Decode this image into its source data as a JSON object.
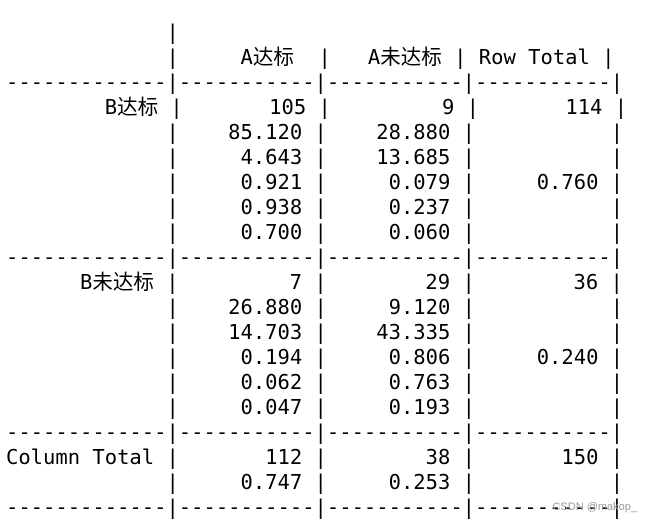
{
  "table": {
    "lines": [
      "             |",
      "             |     A达标  |   A未达标 | Row Total |",
      "-------------|-----------|-----------|-----------|",
      "        B达标 |       105 |         9 |       114 |",
      "             |    85.120 |    28.880 |           |",
      "             |     4.643 |    13.685 |           |",
      "             |     0.921 |     0.079 |     0.760 |",
      "             |     0.938 |     0.237 |           |",
      "             |     0.700 |     0.060 |           |",
      "-------------|-----------|-----------|-----------|",
      "      B未达标 |         7 |        29 |        36 |",
      "             |    26.880 |     9.120 |           |",
      "             |    14.703 |    43.335 |           |",
      "             |     0.194 |     0.806 |     0.240 |",
      "             |     0.062 |     0.763 |           |",
      "             |     0.047 |     0.193 |           |",
      "-------------|-----------|-----------|-----------|",
      "Column Total |       112 |        38 |       150 |",
      "             |     0.747 |     0.253 |           |",
      "-------------|-----------|-----------|-----------|"
    ]
  },
  "watermark": "CSDN @makop_"
}
